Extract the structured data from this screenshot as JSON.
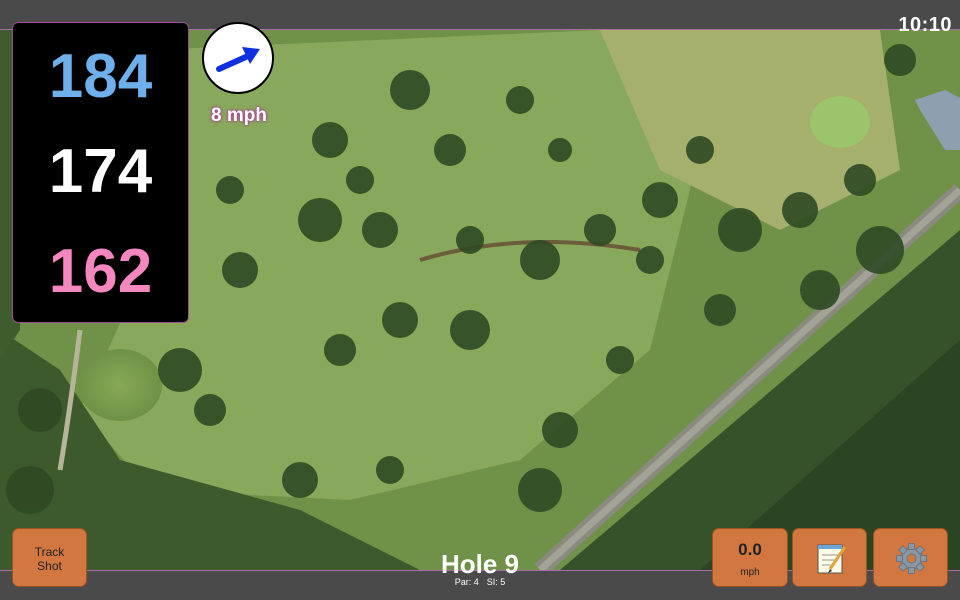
{
  "status": {
    "time": "10:10"
  },
  "distances": {
    "back": "184",
    "middle": "174",
    "front": "162"
  },
  "wind": {
    "speed_label": "8 mph",
    "direction_icon": "wind-arrow-icon"
  },
  "hole": {
    "title": "Hole 9",
    "par_label": "Par: 4",
    "si_label": "SI: 5"
  },
  "buttons": {
    "track_shot_line1": "Track",
    "track_shot_line2": "Shot",
    "speed_value": "0.0",
    "speed_unit": "mph",
    "notes_icon": "notepad-icon",
    "settings_icon": "gear-icon"
  },
  "colors": {
    "back_distance": "#6fb0ec",
    "middle_distance": "#ffffff",
    "front_distance": "#f487c0",
    "button": "#d2773f",
    "accent": "#b06aa8"
  }
}
